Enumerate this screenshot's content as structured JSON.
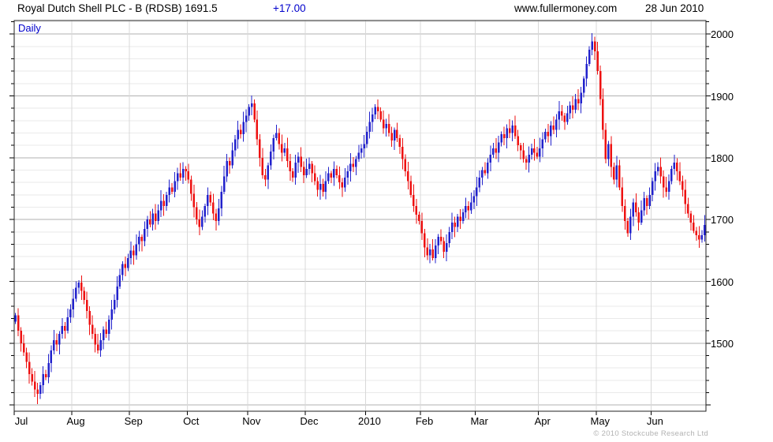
{
  "header": {
    "title": "Royal Dutch Shell PLC - B (RDSB) 1691.5",
    "change": "+17.00",
    "website": "www.fullermoney.com",
    "date": "28 Jun 2010"
  },
  "chart": {
    "interval_label": "Daily",
    "copyright": "© 2010 Stockcube Research Ltd"
  },
  "chart_data": {
    "type": "candlestick",
    "title": "Royal Dutch Shell PLC - B (RDSB) daily candlestick chart",
    "instrument": "Royal Dutch Shell PLC - B",
    "ticker": "RDSB",
    "last_close": 1691.5,
    "change": 17.0,
    "xlabel": "",
    "ylabel": "",
    "ylim": [
      1390,
      2022
    ],
    "y_major_ticks": [
      1500,
      1600,
      1700,
      1800,
      1900,
      2000
    ],
    "y_minor_step": 20,
    "grid_on": true,
    "x_month_ticks": [
      {
        "label": "Jul",
        "index": 0
      },
      {
        "label": "Aug",
        "index": 21
      },
      {
        "label": "Sep",
        "index": 42
      },
      {
        "label": "Oct",
        "index": 63
      },
      {
        "label": "Nov",
        "index": 85
      },
      {
        "label": "Dec",
        "index": 106
      },
      {
        "label": "2010",
        "index": 128
      },
      {
        "label": "Feb",
        "index": 148
      },
      {
        "label": "Mar",
        "index": 168
      },
      {
        "label": "Apr",
        "index": 191
      },
      {
        "label": "May",
        "index": 212
      },
      {
        "label": "Jun",
        "index": 232
      }
    ],
    "first_open": 1535,
    "closes": [
      1545,
      1520,
      1500,
      1485,
      1470,
      1450,
      1438,
      1425,
      1418,
      1432,
      1450,
      1445,
      1468,
      1488,
      1505,
      1498,
      1515,
      1528,
      1520,
      1542,
      1555,
      1572,
      1590,
      1598,
      1585,
      1570,
      1552,
      1530,
      1515,
      1498,
      1488,
      1505,
      1522,
      1515,
      1538,
      1555,
      1570,
      1592,
      1610,
      1628,
      1622,
      1638,
      1650,
      1642,
      1660,
      1672,
      1665,
      1685,
      1700,
      1692,
      1710,
      1698,
      1715,
      1730,
      1722,
      1740,
      1752,
      1745,
      1762,
      1775,
      1768,
      1782,
      1778,
      1765,
      1742,
      1720,
      1700,
      1688,
      1705,
      1722,
      1740,
      1728,
      1710,
      1698,
      1718,
      1745,
      1770,
      1795,
      1788,
      1812,
      1830,
      1845,
      1838,
      1858,
      1868,
      1882,
      1888,
      1862,
      1830,
      1800,
      1772,
      1765,
      1788,
      1810,
      1832,
      1840,
      1822,
      1808,
      1815,
      1795,
      1778,
      1768,
      1792,
      1802,
      1785,
      1772,
      1782,
      1790,
      1775,
      1762,
      1748,
      1758,
      1745,
      1762,
      1775,
      1768,
      1782,
      1772,
      1760,
      1752,
      1768,
      1778,
      1790,
      1785,
      1798,
      1808,
      1815,
      1822,
      1842,
      1858,
      1870,
      1882,
      1875,
      1862,
      1848,
      1855,
      1840,
      1828,
      1845,
      1832,
      1818,
      1798,
      1778,
      1762,
      1740,
      1722,
      1708,
      1698,
      1678,
      1655,
      1642,
      1652,
      1638,
      1658,
      1672,
      1665,
      1648,
      1662,
      1680,
      1695,
      1688,
      1705,
      1698,
      1712,
      1722,
      1715,
      1728,
      1738,
      1752,
      1768,
      1780,
      1775,
      1792,
      1805,
      1815,
      1808,
      1825,
      1838,
      1832,
      1848,
      1840,
      1852,
      1835,
      1820,
      1812,
      1798,
      1792,
      1805,
      1815,
      1808,
      1802,
      1815,
      1830,
      1842,
      1835,
      1852,
      1845,
      1862,
      1875,
      1868,
      1858,
      1872,
      1885,
      1878,
      1895,
      1888,
      1905,
      1928,
      1952,
      1975,
      1988,
      1972,
      1940,
      1895,
      1845,
      1798,
      1822,
      1785,
      1765,
      1788,
      1752,
      1722,
      1698,
      1678,
      1705,
      1728,
      1712,
      1695,
      1715,
      1735,
      1722,
      1740,
      1762,
      1778,
      1785,
      1770,
      1752,
      1745,
      1762,
      1782,
      1792,
      1778,
      1762,
      1748,
      1725,
      1710,
      1695,
      1682,
      1675,
      1668,
      1674.5,
      1691.5
    ],
    "colors": {
      "up": "#2222cc",
      "down": "#ee1111"
    },
    "grid_colors": {
      "major": "#b2b2b2",
      "minor": "#eaeaea",
      "month": "#d8d8d8"
    },
    "legend_position": "none"
  }
}
